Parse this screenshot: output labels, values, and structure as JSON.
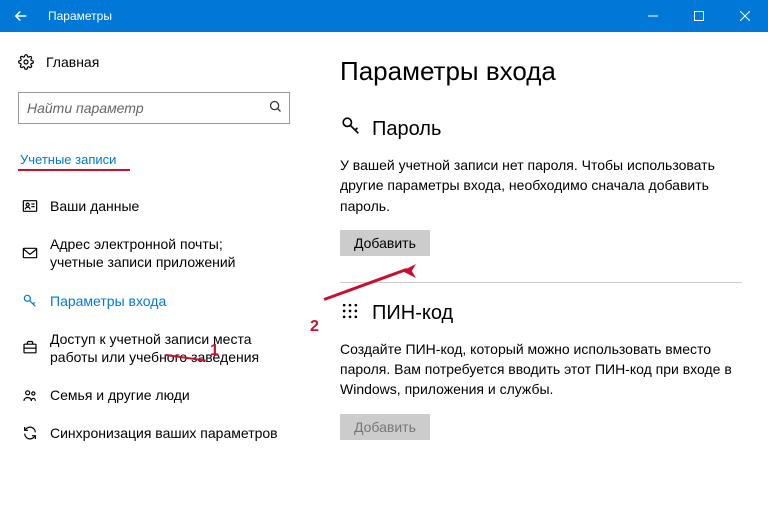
{
  "window": {
    "title": "Параметры"
  },
  "sidebar": {
    "home_label": "Главная",
    "search_placeholder": "Найти параметр",
    "section_header": "Учетные записи",
    "items": [
      {
        "label": "Ваши данные"
      },
      {
        "label": "Адрес электронной почты; учетные записи приложений"
      },
      {
        "label": "Параметры входа"
      },
      {
        "label": "Доступ к учетной записи места работы или учебного заведения"
      },
      {
        "label": "Семья и другие люди"
      },
      {
        "label": "Синхронизация ваших параметров"
      }
    ]
  },
  "main": {
    "heading": "Параметры входа",
    "password": {
      "title": "Пароль",
      "desc": "У вашей учетной записи нет пароля. Чтобы использовать другие параметры входа, необходимо сначала добавить пароль.",
      "button": "Добавить"
    },
    "pin": {
      "title": "ПИН-код",
      "desc": "Создайте ПИН-код, который можно использовать вместо пароля. Вам потребуется вводить этот ПИН-код при входе в Windows, приложения и службы.",
      "button": "Добавить"
    }
  },
  "annotations": {
    "one": "1",
    "two": "2"
  }
}
